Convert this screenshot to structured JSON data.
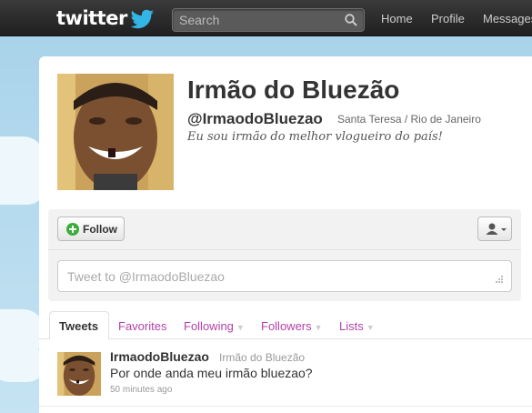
{
  "topbar": {
    "logo": "twitter",
    "search_placeholder": "Search",
    "nav": [
      "Home",
      "Profile",
      "Messages"
    ]
  },
  "profile": {
    "name": "Irmão do Bluezão",
    "handle": "@IrmaodoBluezao",
    "location": "Santa Teresa / Rio de Janeiro",
    "bio": "Eu sou irmão do melhor vlogueiro do país!"
  },
  "actions": {
    "follow_label": "Follow",
    "tweet_placeholder": "Tweet to @IrmaodoBluezao"
  },
  "tabs": {
    "items": [
      "Tweets",
      "Favorites",
      "Following",
      "Followers",
      "Lists"
    ]
  },
  "tweet": {
    "username": "IrmaodoBluezao",
    "name": "Irmão do Bluezão",
    "text": "Por onde anda meu irmão bluezao?",
    "time": "50 minutes ago"
  },
  "colors": {
    "link": "#b540a8",
    "topbar": "#2a2a2a",
    "follow_icon": "#3bad3b"
  }
}
